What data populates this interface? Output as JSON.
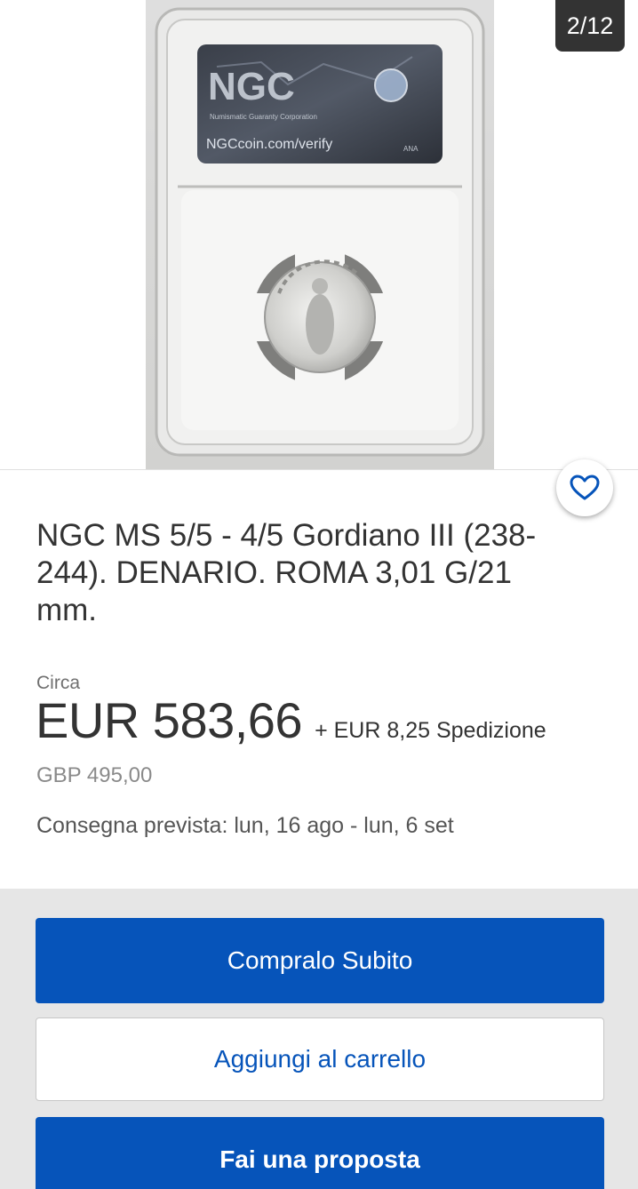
{
  "gallery": {
    "counter": "2/12",
    "slab_label_brand": "NGC",
    "slab_label_url": "NGCcoin.com/verify",
    "slab_label_small": "Numismatic Guaranty Corporation",
    "slab_label_ana": "ANA"
  },
  "favorite": {
    "icon": "heart-outline-icon"
  },
  "listing": {
    "title": "NGC MS 5/5 - 4/5 Gordiano III (238-244). DENARIO. ROMA 3,01 G/21 mm.",
    "circa_label": "Circa",
    "price": "EUR 583,66",
    "shipping": "+ EUR 8,25 Spedizione",
    "original_price": "GBP 495,00",
    "delivery": "Consegna prevista: lun, 16 ago - lun, 6 set"
  },
  "actions": {
    "buy_now": "Compralo Subito",
    "add_to_cart": "Aggiungi al carrello",
    "make_offer": "Fai una proposta"
  },
  "colors": {
    "primary": "#0654ba",
    "counter_bg": "#333333",
    "actions_bg": "#e6e6e6"
  }
}
